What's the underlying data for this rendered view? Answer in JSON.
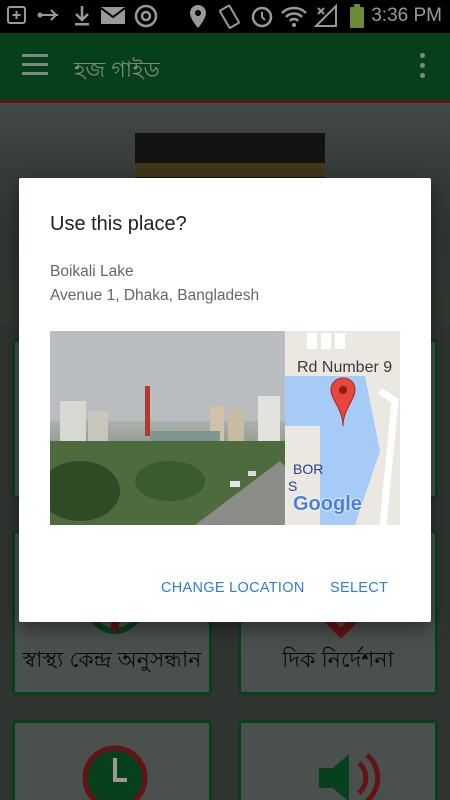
{
  "status_bar": {
    "time": "3:36 PM",
    "icons": [
      "add-box-icon",
      "usb-icon",
      "download-icon",
      "mail-icon",
      "chrome-icon",
      "location-icon",
      "vibrate-icon",
      "alarm-icon",
      "wifi-icon",
      "no-signal-icon",
      "battery-icon"
    ]
  },
  "app_bar": {
    "title": "হজ গাইড",
    "menu_icon": "hamburger-menu-icon",
    "overflow_icon": "more-vert-icon",
    "color": "#0b6b2c",
    "accent_line": "#a81f24"
  },
  "tiles": [
    {
      "label": "স্বাস্থ্য কেন্দ্র অনুসন্ধান",
      "icon": "health-icon"
    },
    {
      "label": "দিক নির্দেশনা",
      "icon": "direction-icon"
    },
    {
      "label": "",
      "icon": "clock-icon"
    },
    {
      "label": "",
      "icon": "speaker-icon"
    }
  ],
  "dialog": {
    "title": "Use this place?",
    "place_name": "Boikali Lake",
    "place_address": "Avenue 1, Dhaka, Bangladesh",
    "map": {
      "road_label": "Rd Number 9",
      "poi_label": "BOR",
      "poi_label2": "S",
      "logo": "Google",
      "pin_icon": "map-pin-icon"
    },
    "buttons": {
      "change_location": "CHANGE LOCATION",
      "select": "SELECT"
    },
    "button_color": "#2d7fd0"
  }
}
